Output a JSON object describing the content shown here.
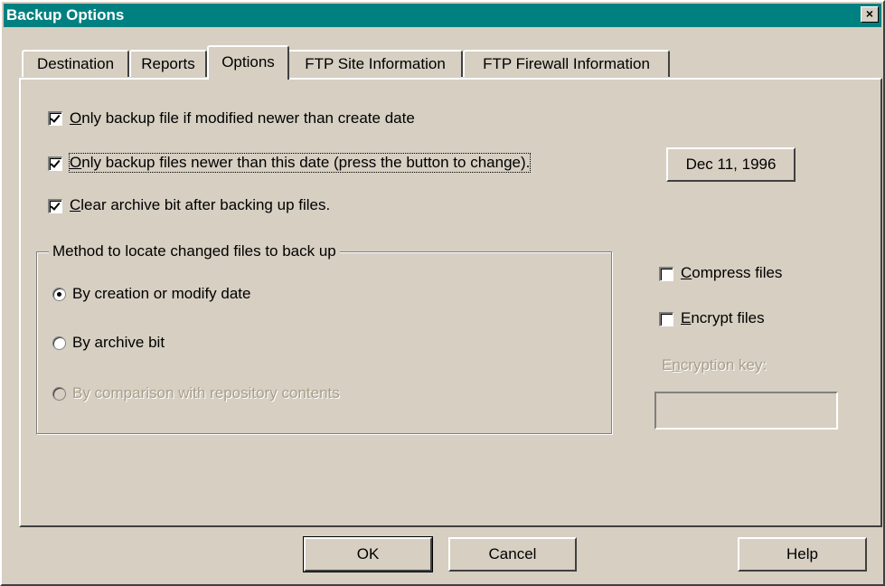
{
  "window": {
    "title": "Backup Options",
    "close_label": "×"
  },
  "tabs": [
    {
      "label": "Destination",
      "active": false
    },
    {
      "label": "Reports",
      "active": false
    },
    {
      "label": "Options",
      "active": true
    },
    {
      "label": "FTP Site Information",
      "active": false
    },
    {
      "label": "FTP Firewall Information",
      "active": false
    }
  ],
  "options": {
    "modified_newer": {
      "mnemonic": "O",
      "rest": "nly backup file if modified newer than create date",
      "checked": true
    },
    "newer_than_date": {
      "mnemonic": "O",
      "rest": "nly backup files newer than this date (press the button to change).",
      "checked": true
    },
    "clear_archive": {
      "mnemonic": "C",
      "rest": "lear archive bit after backing up files.",
      "checked": true
    },
    "date_button": "Dec 11,  1996"
  },
  "method_group": {
    "label": "Method to locate changed files to back up",
    "radios": [
      {
        "label": "By creation or modify date",
        "checked": true,
        "enabled": true
      },
      {
        "label": "By archive bit",
        "checked": false,
        "enabled": true
      },
      {
        "label": "By comparison with repository contents",
        "checked": false,
        "enabled": false
      }
    ]
  },
  "right": {
    "compress": {
      "mnemonic": "C",
      "rest": "ompress files",
      "checked": false
    },
    "encrypt": {
      "mnemonic": "E",
      "rest": "ncrypt files",
      "checked": false
    },
    "encryption_key_label": {
      "pre": "E",
      "mnemonic": "n",
      "rest": "cryption key:"
    },
    "encryption_key_value": ""
  },
  "footer": {
    "ok": "OK",
    "cancel": "Cancel",
    "help": "Help"
  },
  "colors": {
    "face": "#d6cfc2",
    "title": "#008080",
    "disabled_text": "#a89e8a"
  }
}
